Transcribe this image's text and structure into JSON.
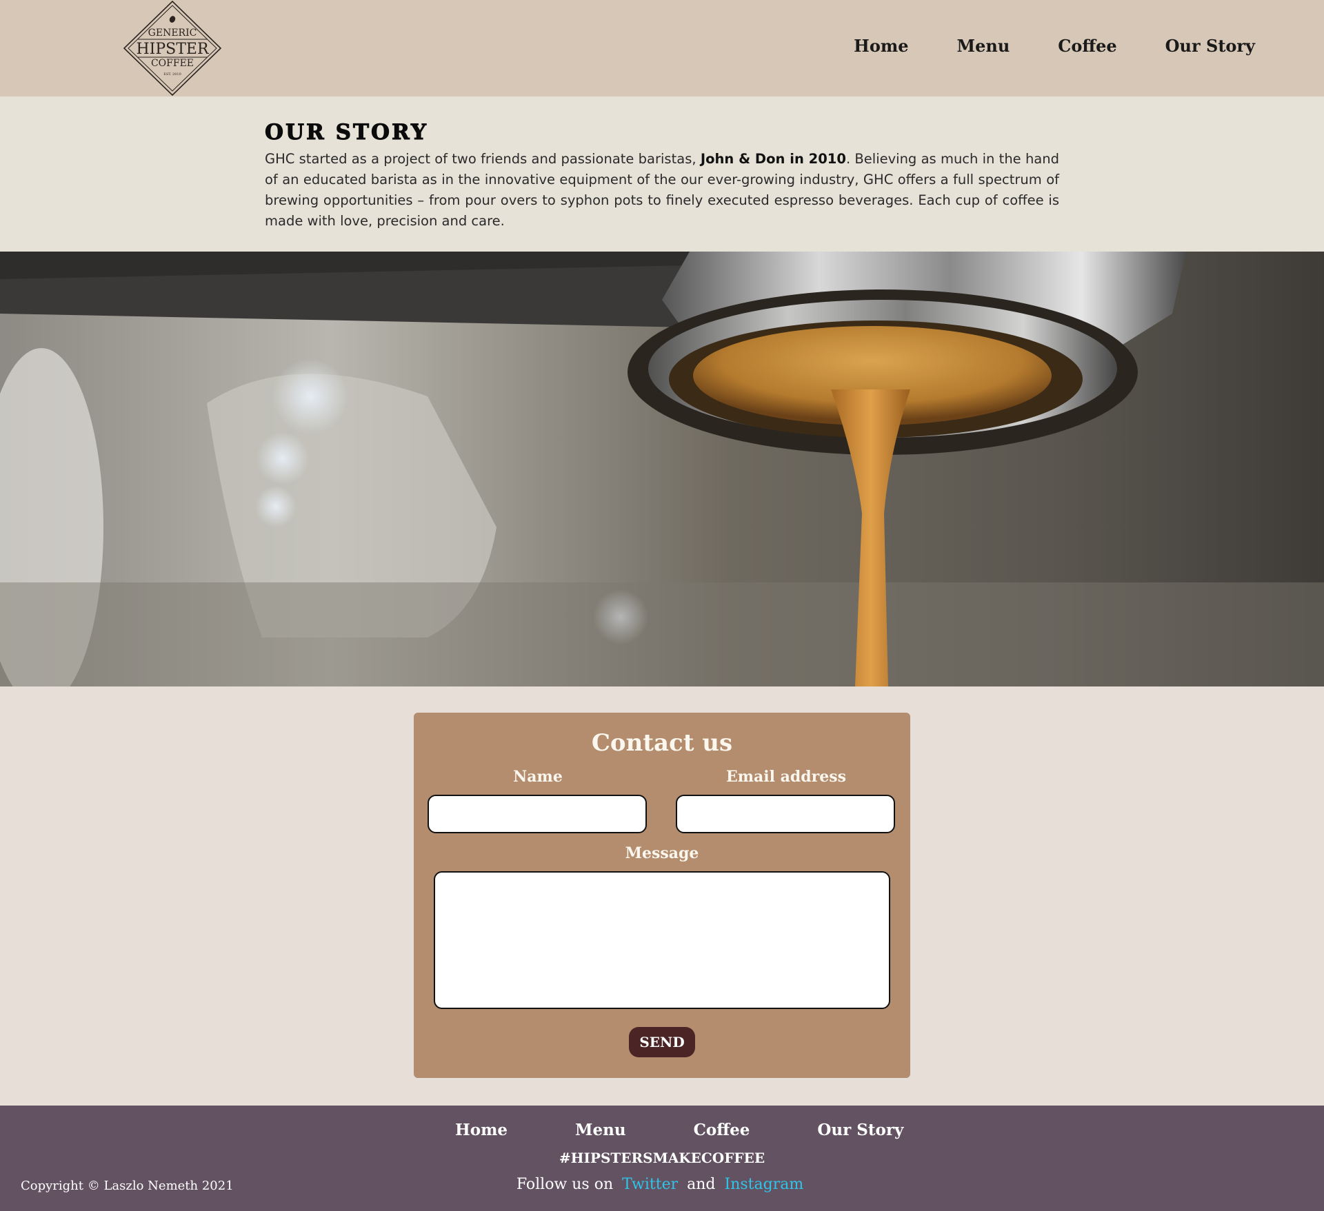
{
  "header": {
    "logo": {
      "line1": "GENERIC",
      "line2": "HIPSTER",
      "line3": "COFFEE",
      "line4": "EST. 2010"
    },
    "nav": [
      {
        "label": "Home"
      },
      {
        "label": "Menu"
      },
      {
        "label": "Coffee"
      },
      {
        "label": "Our Story"
      }
    ]
  },
  "story": {
    "title": "OUR STORY",
    "text_before": "GHC started as a project of two friends and passionate baristas, ",
    "text_bold": "John & Don in 2010",
    "text_after": ". Believing as much in the hand of an educated barista as in the innovative equipment of the our ever-growing industry, GHC offers a full spectrum of brewing opportunities – from pour overs to syphon pots to finely executed espresso beverages. Each cup of coffee is made with love, precision and care."
  },
  "hero": {
    "icon": "espresso-pour-photo"
  },
  "contact": {
    "title": "Contact us",
    "name_label": "Name",
    "email_label": "Email address",
    "message_label": "Message",
    "name_value": "",
    "email_value": "",
    "message_value": "",
    "send_label": "SEND"
  },
  "footer": {
    "nav": [
      {
        "label": "Home"
      },
      {
        "label": "Menu"
      },
      {
        "label": "Coffee"
      },
      {
        "label": "Our Story"
      }
    ],
    "hashtag": "#HIPSTERSMAKECOFFEE",
    "follow_text": "Follow us on",
    "twitter": "Twitter",
    "and_text": "and",
    "instagram": "Instagram",
    "copyright": "Copyright © Laszlo Nemeth 2021"
  },
  "colors": {
    "header_bg": "#d7c7b6",
    "story_bg": "#e6e2d8",
    "page_bg": "#e6ded7",
    "contact_bg": "#b38d6d",
    "send_bg": "#4b2525",
    "footer_bg": "#635262",
    "link_color": "#2fc4e8"
  }
}
